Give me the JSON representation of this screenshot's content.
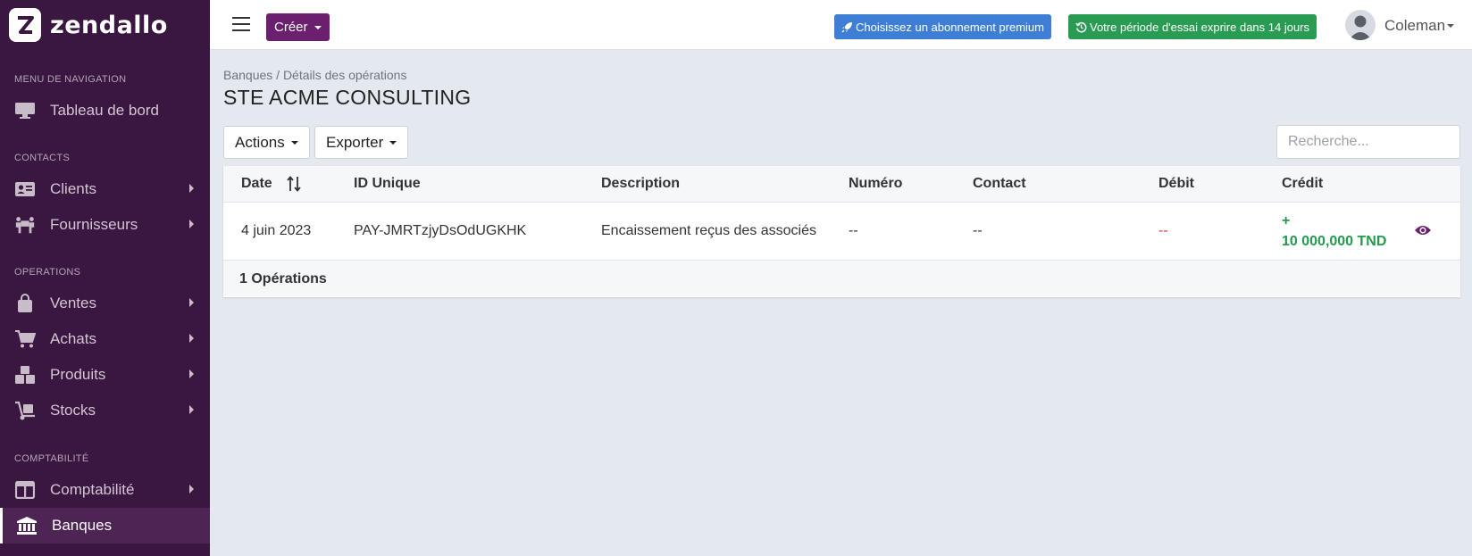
{
  "brand": {
    "name": "zendallo"
  },
  "sidebar": {
    "sections": [
      {
        "title": "MENU DE NAVIGATION",
        "items": [
          {
            "label": "Tableau de bord",
            "icon": "desktop-icon"
          }
        ]
      },
      {
        "title": "CONTACTS",
        "items": [
          {
            "label": "Clients",
            "icon": "address-card-icon"
          },
          {
            "label": "Fournisseurs",
            "icon": "people-carry-icon"
          }
        ]
      },
      {
        "title": "OPERATIONS",
        "items": [
          {
            "label": "Ventes",
            "icon": "shopping-bag-icon"
          },
          {
            "label": "Achats",
            "icon": "cart-icon"
          },
          {
            "label": "Produits",
            "icon": "cubes-icon"
          },
          {
            "label": "Stocks",
            "icon": "dolly-icon"
          }
        ]
      },
      {
        "title": "COMPTABILITÉ",
        "items": [
          {
            "label": "Comptabilité",
            "icon": "columns-icon"
          },
          {
            "label": "Banques",
            "icon": "bank-icon"
          }
        ]
      }
    ]
  },
  "topbar": {
    "create_label": "Créer",
    "premium_label": "Choisissez un abonnement premium",
    "trial_label": "Votre période d'essai exprire dans 14 jours",
    "user_name": "Coleman"
  },
  "main": {
    "breadcrumb": "Banques / Détails des opérations",
    "title": "STE ACME CONSULTING",
    "actions_label": "Actions",
    "export_label": "Exporter",
    "search_placeholder": "Recherche..."
  },
  "table": {
    "columns": [
      "Date",
      "ID Unique",
      "Description",
      "Numéro",
      "Contact",
      "Débit",
      "Crédit"
    ],
    "rows": [
      {
        "date": "4 juin 2023",
        "id": "PAY-JMRTzjyDsOdUGKHK",
        "description": "Encaissement reçus des associés",
        "numero": "--",
        "contact": "--",
        "debit": "--",
        "credit_sign": "+",
        "credit": "10 000,000 TND"
      }
    ],
    "footer": "1 Opérations"
  },
  "colors": {
    "sidebar_bg": "#3a1740",
    "brand_purple": "#6b1f6f",
    "premium_blue": "#3e7ed4",
    "trial_green": "#2a9b52",
    "credit_green": "#239a4e",
    "debit_red": "#e53935"
  }
}
